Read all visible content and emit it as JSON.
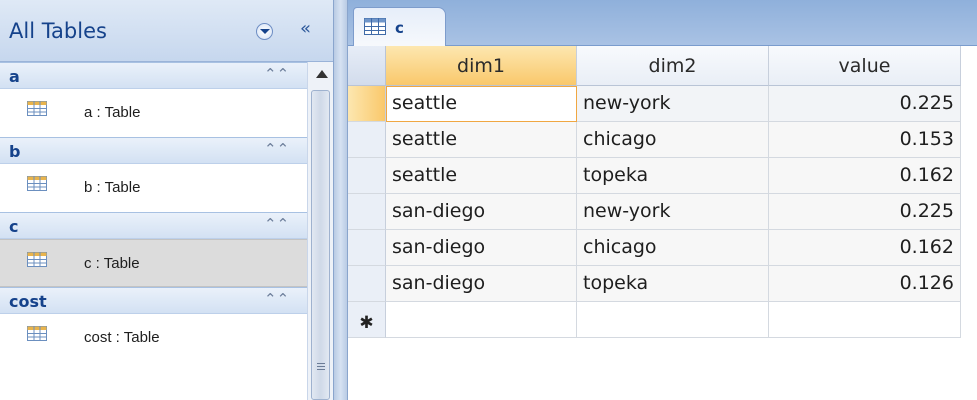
{
  "nav": {
    "title": "All Tables",
    "dropdown_icon": "chevron-down-circle-icon",
    "collapse_label": "«",
    "groups": [
      {
        "name": "a",
        "items": [
          {
            "label": "a : Table"
          }
        ]
      },
      {
        "name": "b",
        "items": [
          {
            "label": "b : Table"
          }
        ]
      },
      {
        "name": "c",
        "items": [
          {
            "label": "c : Table"
          }
        ]
      },
      {
        "name": "cost",
        "items": [
          {
            "label": "cost : Table"
          }
        ]
      }
    ],
    "group_collapse_label": "⌃⌃",
    "selected_group": "c"
  },
  "tab": {
    "label": "c"
  },
  "table": {
    "columns": [
      "dim1",
      "dim2",
      "value"
    ],
    "rows": [
      [
        "seattle",
        "new-york",
        "0.225"
      ],
      [
        "seattle",
        "chicago",
        "0.153"
      ],
      [
        "seattle",
        "topeka",
        "0.162"
      ],
      [
        "san-diego",
        "new-york",
        "0.225"
      ],
      [
        "san-diego",
        "chicago",
        "0.162"
      ],
      [
        "san-diego",
        "topeka",
        "0.126"
      ]
    ],
    "new_row_marker": "✱"
  },
  "colors": {
    "accent": "#15428b",
    "active_header": "#f9c86b",
    "tab_strip": "#8fb0db"
  }
}
